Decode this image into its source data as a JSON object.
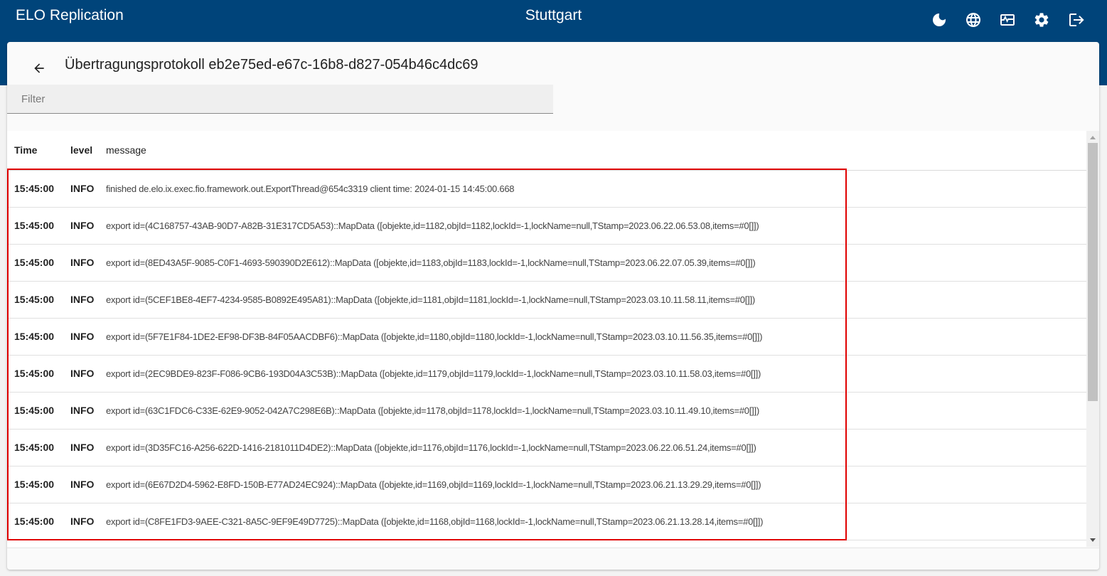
{
  "header": {
    "app_title": "ELO Replication",
    "location": "Stuttgart",
    "icons": [
      "theme-moon-icon",
      "language-globe-icon",
      "monitor-health-icon",
      "settings-gear-icon",
      "logout-icon"
    ]
  },
  "page": {
    "back_icon": "arrow-left-icon",
    "title": "Übertragungsprotokoll eb2e75ed-e67c-16b8-d827-054b46c4dc69"
  },
  "filter": {
    "placeholder": "Filter",
    "value": ""
  },
  "table": {
    "columns": {
      "time": "Time",
      "level": "level",
      "message": "message"
    },
    "rows": [
      {
        "time": "15:45:00",
        "level": "INFO",
        "message": "finished de.elo.ix.exec.fio.framework.out.ExportThread@654c3319 client time: 2024-01-15 14:45:00.668"
      },
      {
        "time": "15:45:00",
        "level": "INFO",
        "message": "export id=(4C168757-43AB-90D7-A82B-31E317CD5A53)::MapData ([objekte,id=1182,objId=1182,lockId=-1,lockName=null,TStamp=2023.06.22.06.53.08,items=#0[]])"
      },
      {
        "time": "15:45:00",
        "level": "INFO",
        "message": "export id=(8ED43A5F-9085-C0F1-4693-590390D2E612)::MapData ([objekte,id=1183,objId=1183,lockId=-1,lockName=null,TStamp=2023.06.22.07.05.39,items=#0[]])"
      },
      {
        "time": "15:45:00",
        "level": "INFO",
        "message": "export id=(5CEF1BE8-4EF7-4234-9585-B0892E495A81)::MapData ([objekte,id=1181,objId=1181,lockId=-1,lockName=null,TStamp=2023.03.10.11.58.11,items=#0[]])"
      },
      {
        "time": "15:45:00",
        "level": "INFO",
        "message": "export id=(5F7E1F84-1DE2-EF98-DF3B-84F05AACDBF6)::MapData ([objekte,id=1180,objId=1180,lockId=-1,lockName=null,TStamp=2023.03.10.11.56.35,items=#0[]])"
      },
      {
        "time": "15:45:00",
        "level": "INFO",
        "message": "export id=(2EC9BDE9-823F-F086-9CB6-193D04A3C53B)::MapData ([objekte,id=1179,objId=1179,lockId=-1,lockName=null,TStamp=2023.03.10.11.58.03,items=#0[]])"
      },
      {
        "time": "15:45:00",
        "level": "INFO",
        "message": "export id=(63C1FDC6-C33E-62E9-9052-042A7C298E6B)::MapData ([objekte,id=1178,objId=1178,lockId=-1,lockName=null,TStamp=2023.03.10.11.49.10,items=#0[]])"
      },
      {
        "time": "15:45:00",
        "level": "INFO",
        "message": "export id=(3D35FC16-A256-622D-1416-2181011D4DE2)::MapData ([objekte,id=1176,objId=1176,lockId=-1,lockName=null,TStamp=2023.06.22.06.51.24,items=#0[]])"
      },
      {
        "time": "15:45:00",
        "level": "INFO",
        "message": "export id=(6E67D2D4-5962-E8FD-150B-E77AD24EC924)::MapData ([objekte,id=1169,objId=1169,lockId=-1,lockName=null,TStamp=2023.06.21.13.29.29,items=#0[]])"
      },
      {
        "time": "15:45:00",
        "level": "INFO",
        "message": "export id=(C8FE1FD3-9AEE-C321-8A5C-9EF9E49D7725)::MapData ([objekte,id=1168,objId=1168,lockId=-1,lockName=null,TStamp=2023.06.21.13.28.14,items=#0[]])"
      }
    ]
  },
  "colors": {
    "header_bg": "#00447a",
    "highlight_border": "#e00000"
  }
}
